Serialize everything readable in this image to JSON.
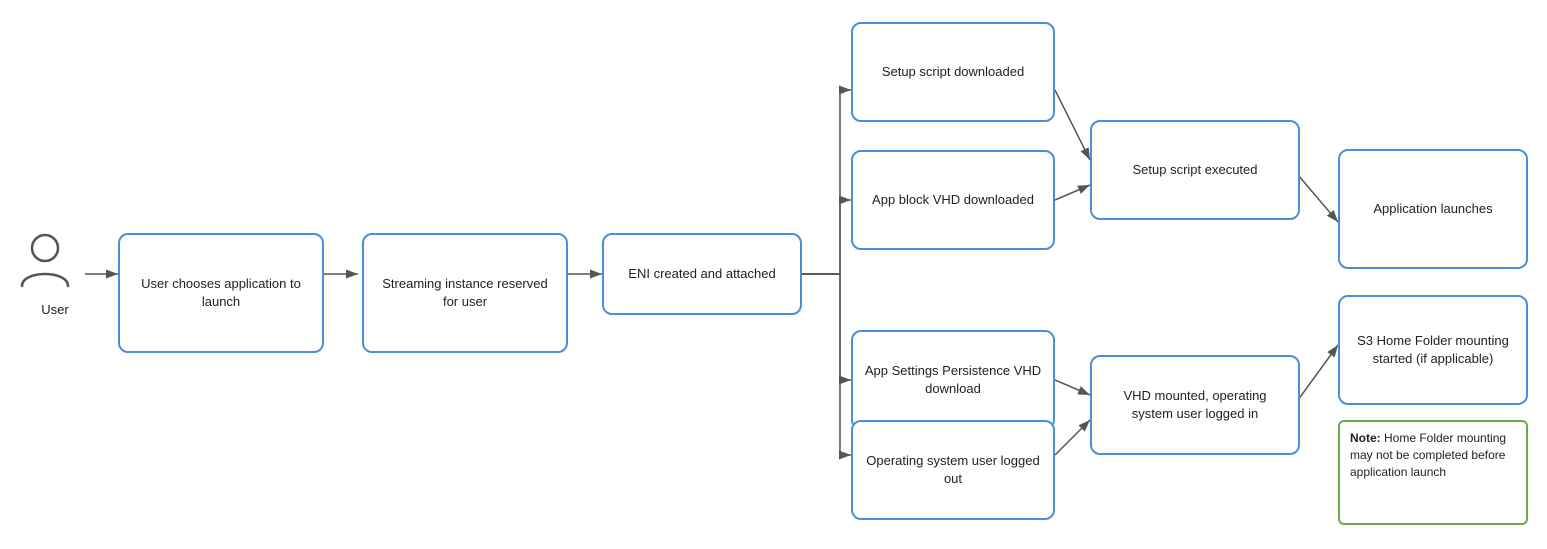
{
  "nodes": {
    "user_label": "User",
    "user_chooses": "User chooses application to launch",
    "streaming_instance": "Streaming instance reserved for user",
    "eni_created": "ENI created and attached",
    "setup_script_dl": "Setup script downloaded",
    "app_block_vhd": "App block VHD downloaded",
    "app_settings_vhd": "App Settings Persistence VHD download",
    "os_user_logged": "Operating system user logged out",
    "setup_script_exec": "Setup script executed",
    "vhd_mounted": "VHD mounted, operating system user logged in",
    "app_launches": "Application launches",
    "s3_home": "S3 Home Folder mounting started (if applicable)",
    "note_bold": "Note:",
    "note_text": " Home Folder mounting may not be completed before application launch"
  }
}
